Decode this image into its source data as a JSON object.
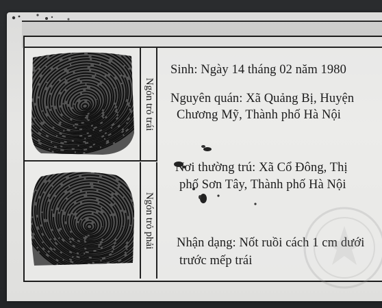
{
  "fingerprint_labels": {
    "left_index": "Ngón trỏ trái",
    "right_index": "Ngón trỏ phải"
  },
  "info": {
    "birth": "Sinh: Ngày 14 tháng 02 năm 1980",
    "origin_line1": "Nguyên quán: Xã Quảng Bị, Huyện",
    "origin_line2": "Chương Mỹ, Thành phố Hà Nội",
    "residence_line1": "Nơi thường trú: Xã Cổ Đông, Thị",
    "residence_line2": "phố Sơn Tây, Thành phố Hà Nội",
    "features_line1": "Nhận dạng: Nốt ruồi cách 1 cm dưới",
    "features_line2": "trước mếp trái"
  },
  "colors": {
    "ink": "#1c1c1c",
    "card": "#e2e2e0",
    "background": "#232527"
  }
}
